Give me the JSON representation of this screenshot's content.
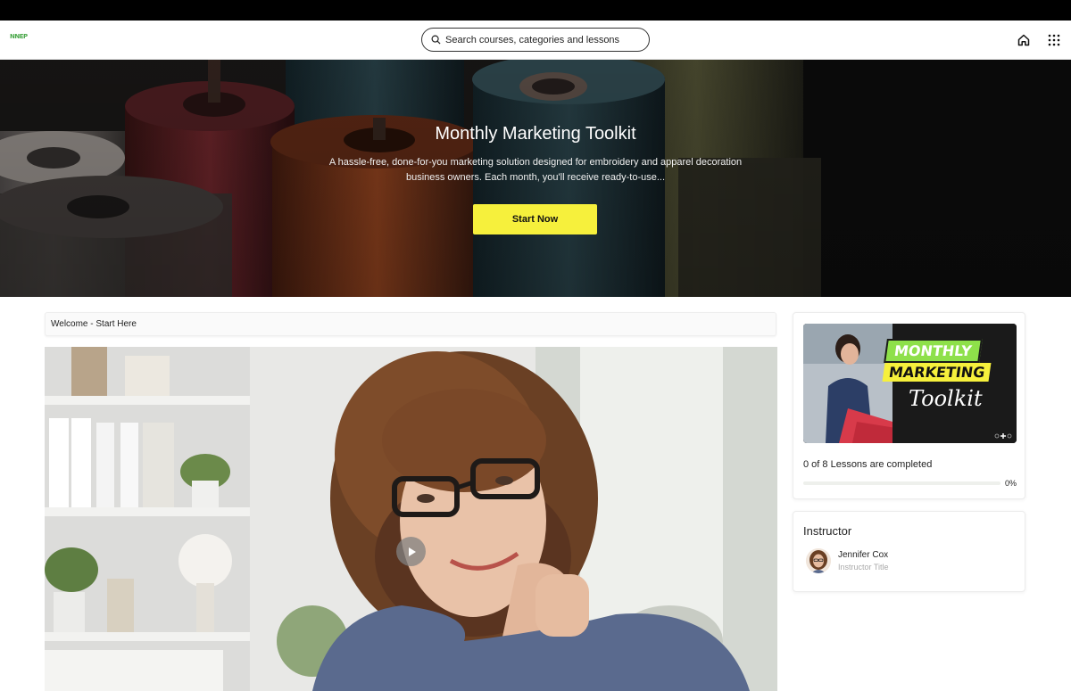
{
  "header": {
    "logo_text": "NNEP",
    "search_placeholder": "Search courses, categories and lessons",
    "icons": [
      "home-icon",
      "apps-grid-icon",
      "search-icon"
    ]
  },
  "hero": {
    "title": "Monthly Marketing Toolkit",
    "description": "A hassle-free, done-for-you marketing solution designed for embroidery and apparel decoration business owners. Each month, you'll receive ready-to-use...",
    "cta_label": "Start Now"
  },
  "lesson": {
    "current_title": "Welcome - Start Here"
  },
  "course_card": {
    "thumbnail_lines": [
      "MONTHLY",
      "MARKETING",
      "Toolkit"
    ],
    "progress_text": "0 of 8 Lessons are completed",
    "progress_fraction": 0,
    "progress_percent_label": "0%"
  },
  "instructor": {
    "heading": "Instructor",
    "name": "Jennifer Cox",
    "title": "Instructor Title"
  },
  "colors": {
    "accent_yellow": "#f6f03c",
    "brand_green": "#4aa84a",
    "thumbnail_green": "#8ee04a"
  }
}
